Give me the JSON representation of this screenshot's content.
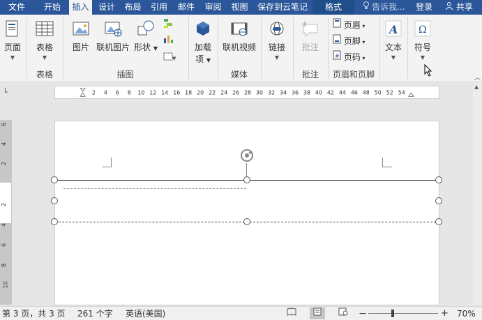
{
  "tabs": [
    {
      "label": "文件"
    },
    {
      "label": "开始"
    },
    {
      "label": "插入"
    },
    {
      "label": "设计"
    },
    {
      "label": "布局"
    },
    {
      "label": "引用"
    },
    {
      "label": "邮件"
    },
    {
      "label": "审阅"
    },
    {
      "label": "视图"
    },
    {
      "label": "保存到云笔记"
    },
    {
      "label": "格式"
    }
  ],
  "active_tab": "插入",
  "tell_me": "告诉我...",
  "login": "登录",
  "share": "共享",
  "ribbon": {
    "pages": {
      "label": "页面",
      "icon": "pages-icon"
    },
    "table": {
      "label": "表格",
      "group": "表格",
      "icon": "table-icon"
    },
    "picture": {
      "label": "图片",
      "icon": "picture-icon"
    },
    "online_picture": {
      "label": "联机图片",
      "icon": "online-picture-icon"
    },
    "shapes": {
      "label": "形状",
      "icon": "shapes-icon"
    },
    "illustrations_group": "插图",
    "addins": {
      "label": "加载项",
      "label_line2": "项",
      "icon": "addins-icon"
    },
    "online_video": {
      "label": "联机视频",
      "icon": "online-video-icon"
    },
    "media_group": "媒体",
    "link": {
      "label": "链接",
      "icon": "link-icon"
    },
    "comment": {
      "label": "批注",
      "group": "批注",
      "icon": "comment-icon"
    },
    "header": {
      "label": "页眉"
    },
    "footer": {
      "label": "页脚"
    },
    "page_number": {
      "label": "页码"
    },
    "header_footer_group": "页眉和页脚",
    "text": {
      "label": "文本",
      "icon": "text-icon"
    },
    "symbol": {
      "label": "符号",
      "icon": "omega-icon"
    }
  },
  "ruler_numbers": [
    "2",
    "4",
    "6",
    "8",
    "10",
    "12",
    "14",
    "16",
    "18",
    "20",
    "22",
    "24",
    "26",
    "28",
    "30",
    "32",
    "34",
    "36",
    "38",
    "40",
    "42",
    "44",
    "46",
    "48",
    "50",
    "52",
    "54"
  ],
  "vruler_numbers": [
    "6",
    "4",
    "2",
    "2",
    "4",
    "6",
    "8",
    "10"
  ],
  "status": {
    "page": "第 3 页，共 3 页",
    "words": "261 个字",
    "language": "英语(美国)",
    "zoom": "70%"
  },
  "colors": {
    "accent": "#2b579a"
  }
}
